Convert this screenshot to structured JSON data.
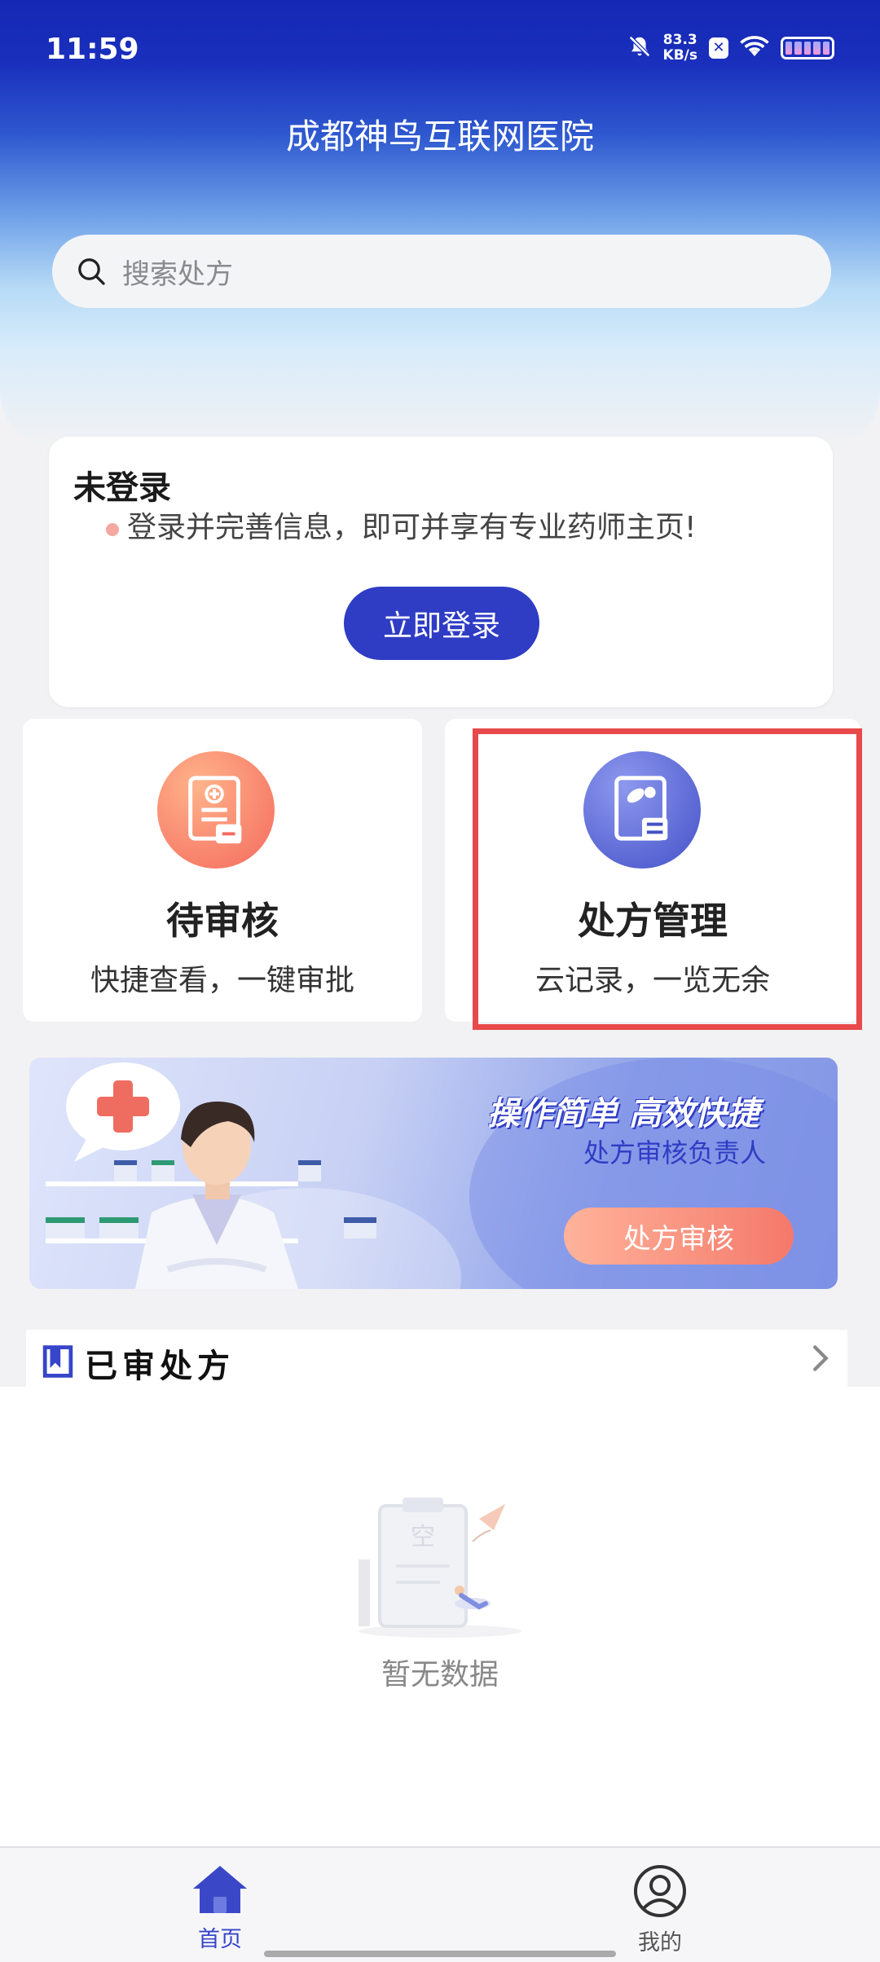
{
  "status_bar": {
    "time": "11:59",
    "net_speed_value": "83.3",
    "net_speed_unit": "KB/s",
    "icons": [
      "mute-bell-icon",
      "x-badge-icon",
      "wifi-icon",
      "battery-icon"
    ]
  },
  "header": {
    "title": "成都神鸟互联网医院"
  },
  "search": {
    "placeholder": "搜索处方",
    "icon": "search-icon"
  },
  "login_card": {
    "title": "未登录",
    "tip": "登录并完善信息，即可并享有专业药师主页!",
    "button": "立即登录"
  },
  "features": [
    {
      "title": "待审核",
      "subtitle": "快捷查看，一键审批",
      "icon": "pending-review-icon",
      "color": "#f46a5e"
    },
    {
      "title": "处方管理",
      "subtitle": "云记录，一览无余",
      "icon": "prescription-management-icon",
      "color": "#4451c8"
    }
  ],
  "banner": {
    "headline": "操作简单 高效快捷",
    "subline": "处方审核负责人",
    "button": "处方审核"
  },
  "reviewed_section": {
    "title": "已审处方",
    "empty_text": "暂无数据",
    "empty_watermark": "空"
  },
  "tab_bar": {
    "tabs": [
      {
        "label": "首页",
        "icon": "home-icon",
        "active": true
      },
      {
        "label": "我的",
        "icon": "profile-icon",
        "active": false
      }
    ]
  },
  "colors": {
    "brand_blue": "#1a2fbc",
    "accent_blue": "#2f3cc4",
    "highlight_red": "#e8494a",
    "accent_orange": "#f4796b"
  }
}
